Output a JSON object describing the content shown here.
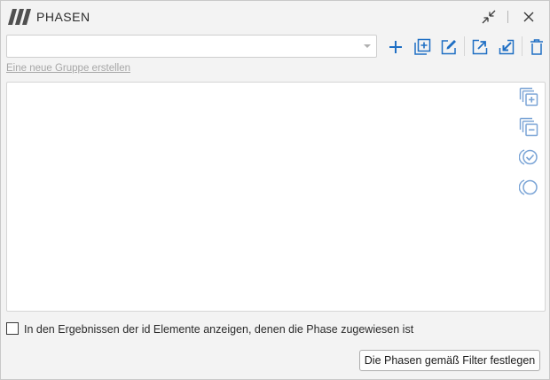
{
  "window": {
    "title": "PHASEN"
  },
  "group_selector": {
    "value": ""
  },
  "links": {
    "new_group": "Eine neue Gruppe erstellen"
  },
  "toolbar": {
    "icons": [
      "add-icon",
      "duplicate-icon",
      "edit-icon",
      "export-icon",
      "import-icon",
      "delete-icon"
    ],
    "accent_color": "#1f6fc4"
  },
  "side_actions": {
    "icons": [
      "expand-all-icon",
      "collapse-all-icon",
      "check-all-icon",
      "uncheck-all-icon"
    ],
    "color": "#7aa4d6"
  },
  "options": {
    "show_elements_checkbox": {
      "label": "In den Ergebnissen der id Elemente anzeigen, denen die Phase zugewiesen ist",
      "checked": false
    }
  },
  "footer": {
    "apply_button": "Die Phasen gemäß Filter festlegen"
  }
}
